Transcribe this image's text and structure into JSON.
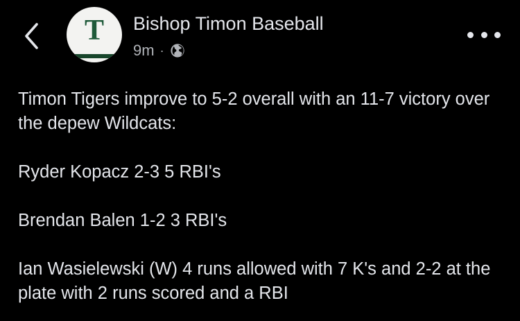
{
  "post": {
    "author": "Bishop Timon Baseball",
    "timestamp": "9m",
    "separator": "·",
    "privacy_icon": "globe-icon",
    "avatar_letter": "T",
    "paragraphs": [
      "Timon Tigers improve to 5-2 overall with an 11-7 victory over the depew Wildcats:",
      "Ryder Kopacz 2-3 5 RBI's",
      "Brendan Balen 1-2 3 RBI's",
      "Ian Wasielewski (W) 4 runs allowed with 7 K's and 2-2 at the plate with 2 runs scored and a RBI"
    ]
  },
  "icons": {
    "back": "chevron-left-icon",
    "more": "more-horizontal-icon"
  },
  "colors": {
    "background": "#000000",
    "primary_text": "#e4e6eb",
    "secondary_text": "#b0b3b8",
    "avatar_green": "#1f5a3a"
  }
}
